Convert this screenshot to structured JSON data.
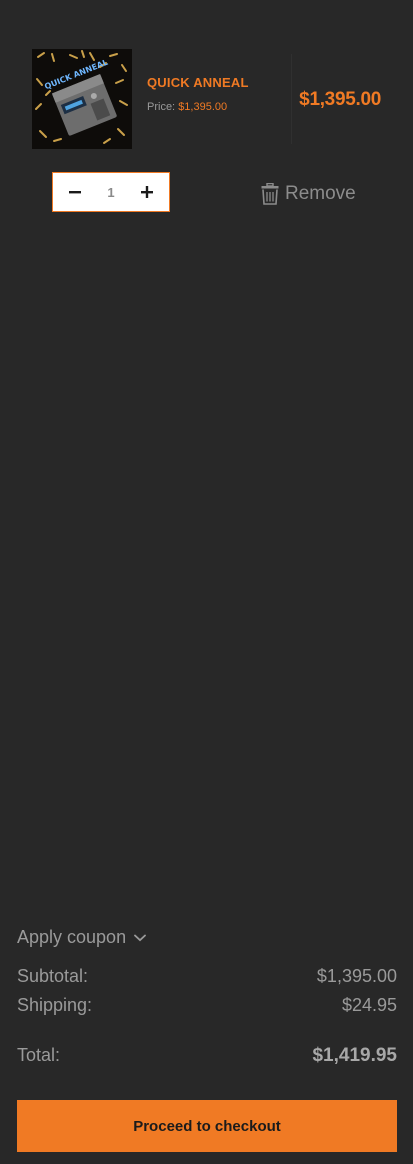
{
  "cart_item": {
    "name": "QUICK ANNEAL",
    "price_label": "Price:",
    "price_value": "$1,395.00",
    "line_total": "$1,395.00",
    "image_alt": "Quick Anneal machine",
    "image_text": "QUICK ANNEAL",
    "quantity": "1",
    "remove_label": "Remove"
  },
  "summary": {
    "coupon_label": "Apply coupon",
    "subtotal_label": "Subtotal:",
    "subtotal_value": "$1,395.00",
    "shipping_label": "Shipping:",
    "shipping_value": "$24.95",
    "total_label": "Total:",
    "total_value": "$1,419.95"
  },
  "checkout_label": "Proceed to checkout",
  "colors": {
    "background": "#282828",
    "accent": "#f07a24"
  },
  "icons": {
    "decrease": "minus-icon",
    "increase": "plus-icon",
    "remove": "trash-icon",
    "coupon": "chevron-down-icon"
  }
}
